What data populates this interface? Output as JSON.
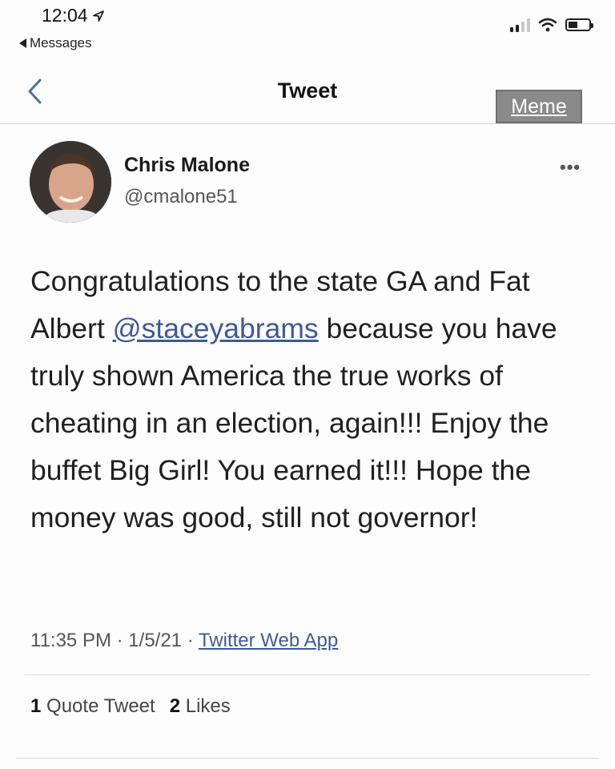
{
  "status_bar": {
    "time": "12:04",
    "back_app": "Messages"
  },
  "nav": {
    "title": "Tweet",
    "badge": "Meme"
  },
  "author": {
    "name": "Chris Malone",
    "handle": "@cmalone51"
  },
  "tweet": {
    "text_before_mention": "Congratulations to the state GA and Fat Albert",
    "mention": "@staceyabrams",
    "text_after_mention": "because you have truly shown America the true works of cheating in an election, again!!!  Enjoy the buffet Big Girl!  You earned it!!!  Hope the money was good, still not governor!"
  },
  "meta": {
    "time": "11:35 PM",
    "date": "1/5/21",
    "separator": "·",
    "source": "Twitter Web App"
  },
  "stats": {
    "quote_count": "1",
    "quote_label": "Quote Tweet",
    "like_count": "2",
    "like_label": "Likes"
  },
  "colors": {
    "link": "#3d5a99",
    "badge_bg": "#8a8a8a"
  }
}
